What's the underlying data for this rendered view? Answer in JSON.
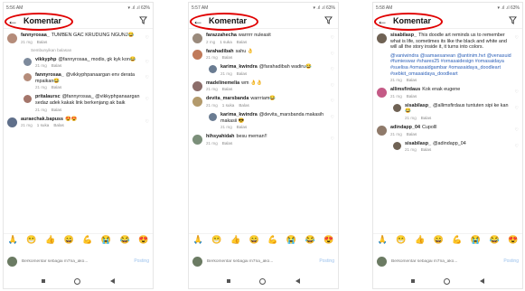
{
  "common": {
    "title": "Komentar",
    "reply_label": "Balas",
    "input_placeholder": "Berkomentar sebagai m7na_ako...",
    "post_label": "Posting",
    "emojis": [
      "🙏",
      "😁",
      "👍",
      "😄",
      "💪",
      "😭",
      "😂",
      "😍"
    ]
  },
  "screens": [
    {
      "status_time": "5:56 AM",
      "status_icons": "▾ .ıl .ıl 63%",
      "comments": [
        {
          "kind": "comment",
          "user": "fannyrosaa_",
          "text": "TUMBEN GAC KRUDUNG NGUNJ😂",
          "time": "21 mg",
          "likes": "",
          "avatar_color": "#b58c7a"
        },
        {
          "kind": "more",
          "text": "Sembunyikan balasan"
        },
        {
          "kind": "reply",
          "user": "vikkyphp",
          "text": "@fannyrosaa_ modis, gk kyk kon😂",
          "time": "21 mg",
          "likes": "",
          "avatar_color": "#7d8a9c"
        },
        {
          "kind": "reply",
          "user": "fannyrosaa_",
          "text": "@vikkyphpanaargan env derata mpaikan😂",
          "time": "21 mg",
          "likes": "",
          "avatar_color": "#b58c7a"
        },
        {
          "kind": "reply",
          "user": "pritalaursc",
          "text": "@fannyrosaa_ @vikkyphpanaargan sedaz adek kakak link berkenjang ak baik",
          "time": "21 mg",
          "likes": "",
          "avatar_color": "#a4756a"
        },
        {
          "kind": "comment",
          "user": "auraechak.bapuss",
          "text": "😍😍",
          "time": "21 mg",
          "likes": "1 suka",
          "avatar_color": "#5f6f8a"
        }
      ]
    },
    {
      "status_time": "5:57 AM",
      "status_icons": "▾ .ıl .ıl 63%",
      "comments": [
        {
          "kind": "comment",
          "user": "farazzahecha",
          "text": "warrrrr nuleasit",
          "time": "2 mg",
          "likes": "1 suka",
          "avatar_color": "#9a8a7c"
        },
        {
          "kind": "comment",
          "user": "farahadibah",
          "text": "sahu 👌",
          "time": "21 mg",
          "likes": "",
          "avatar_color": "#c07a5a"
        },
        {
          "kind": "reply",
          "user": "karima_kwindra",
          "text": "@farahadibah wadiru😂",
          "time": "21 mg",
          "likes": "",
          "avatar_color": "#6a7c92"
        },
        {
          "kind": "comment",
          "user": "madelinemelia",
          "text": "wm 👌👌",
          "time": "21 mg",
          "likes": "",
          "avatar_color": "#8c6d6a"
        },
        {
          "kind": "comment",
          "user": "devita_marsbanda",
          "text": "warrriam😂",
          "time": "21 mg",
          "likes": "1 suka",
          "avatar_color": "#b39a6c"
        },
        {
          "kind": "reply",
          "user": "karima_kwindra",
          "text": "@devita_marsbanda makasih makasii 😎",
          "time": "21 mg",
          "likes": "",
          "avatar_color": "#6a7c92"
        },
        {
          "kind": "comment",
          "user": "hihsyahidah",
          "text": "besu meman!!",
          "time": "21 mg",
          "likes": "",
          "avatar_color": "#7b8f7a"
        }
      ]
    },
    {
      "status_time": "5:58 AM",
      "status_icons": "▾ .ıl .ıl 63%",
      "comments": [
        {
          "kind": "comment",
          "user": "sisabilasp_",
          "text": "This doodle art reminds us to remember what is life, sometimes its like the black and white and will all the story inside it, it turns into colors.",
          "tags": "@vaniwindra @samaesanean @antinim.hvt @venasuid #fumieswar #shares25 #ornasaidesign #omasaidaya #suelisa #omasaidgambar #omasaidaya_doodleart #sebkit_omasaidaya_doodleart",
          "time": "21 mg",
          "likes": "",
          "avatar_color": "#6f6254"
        },
        {
          "kind": "comment",
          "user": "allimsfirdaus",
          "text": "Kok enak eugene",
          "time": "21 mg",
          "likes": "",
          "avatar_color": "#c45a86"
        },
        {
          "kind": "reply",
          "user": "sisabilasp_",
          "text": "@allimsfirdaus tuntuten sipi ke kan😂",
          "time": "21 mg",
          "likes": "",
          "avatar_color": "#6f6254"
        },
        {
          "kind": "comment",
          "user": "adindapp_04",
          "text": "Cupolll",
          "time": "21 mg",
          "likes": "",
          "avatar_color": "#8f7a6a"
        },
        {
          "kind": "reply",
          "user": "sisabilasp_",
          "text": "@adindapp_04",
          "time": "21 mg",
          "likes": "",
          "avatar_color": "#6f6254"
        }
      ]
    }
  ]
}
